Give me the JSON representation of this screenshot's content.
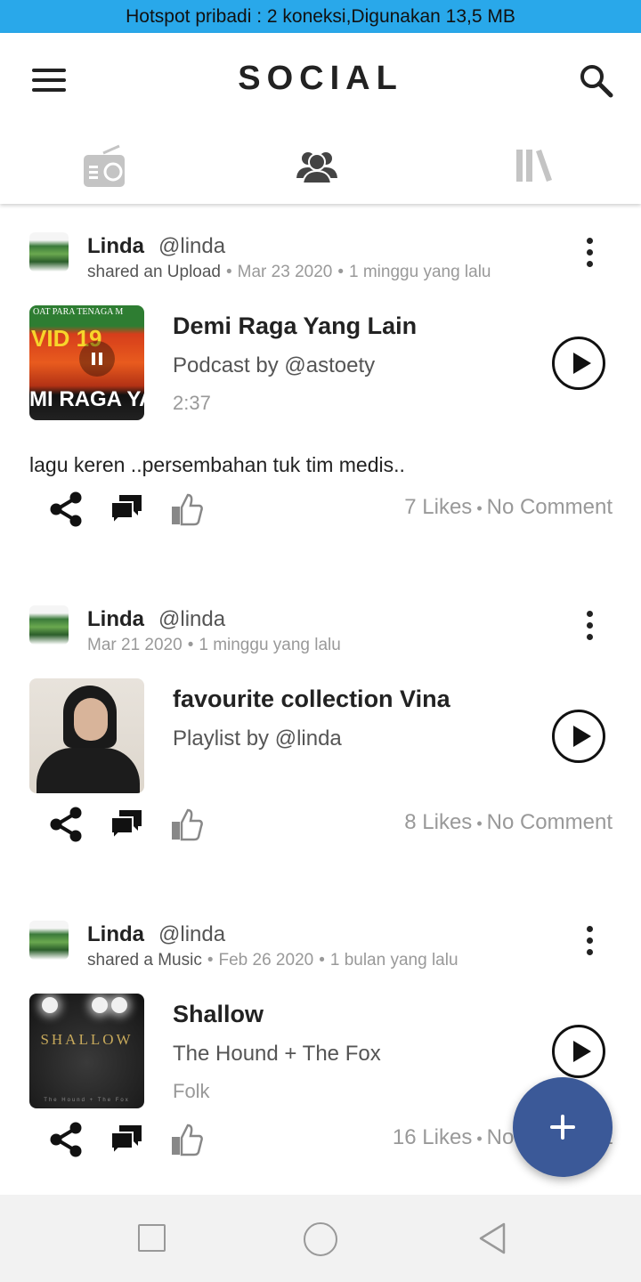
{
  "status_bar": {
    "text": "Hotspot pribadi : 2 koneksi,Digunakan 13,5 MB"
  },
  "header": {
    "title": "SOCIAL"
  },
  "tabs": [
    {
      "name": "radio",
      "icon": "radio-icon"
    },
    {
      "name": "social",
      "icon": "people-icon",
      "active": true
    },
    {
      "name": "library",
      "icon": "library-icon"
    }
  ],
  "posts": [
    {
      "user": "Linda",
      "handle": "@linda",
      "action": "shared an Upload",
      "date": "Mar 23 2020",
      "ago": "1 minggu yang lalu",
      "media": {
        "title": "Demi Raga Yang Lain",
        "subtitle": "Podcast by @astoety",
        "extra": "2:37",
        "thumb_text_top": "OAT PARA TENAGA M",
        "thumb_text_mid": "VID 19",
        "thumb_text_bottom": "MI RAGA YANG"
      },
      "caption": "lagu keren ..persembahan tuk tim medis..",
      "likes": "7 Likes",
      "comments": "No Comment"
    },
    {
      "user": "Linda",
      "handle": "@linda",
      "action": "",
      "date": "Mar 21 2020",
      "ago": "1 minggu yang lalu",
      "media": {
        "title": "favourite collection Vina",
        "subtitle": "Playlist by @linda",
        "extra": ""
      },
      "caption": "",
      "likes": "8 Likes",
      "comments": "No Comment"
    },
    {
      "user": "Linda",
      "handle": "@linda",
      "action": "shared a Music",
      "date": "Feb 26 2020",
      "ago": "1 bulan yang lalu",
      "media": {
        "title": "Shallow",
        "subtitle": "The Hound + The Fox",
        "extra": "Folk",
        "thumb_word": "SHALLOW",
        "thumb_sub": "The Hound + The Fox"
      },
      "caption": "",
      "likes": "16 Likes",
      "comments": "No Comment"
    }
  ],
  "colors": {
    "status_bar": "#29a8ea",
    "fab": "#3b5998",
    "text_muted": "#999999"
  }
}
